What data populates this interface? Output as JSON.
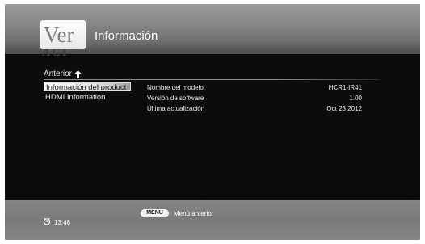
{
  "header": {
    "logo_text": "Ver",
    "logo_reflection": "AGI",
    "title": "Información"
  },
  "nav": {
    "back_label": "Anterior",
    "items": [
      {
        "label": "Información del product",
        "selected": true
      },
      {
        "label": "HDMI Information",
        "selected": false
      }
    ]
  },
  "info": {
    "rows": [
      {
        "label": "Nombre del modelo",
        "value": "HCR1-IR41"
      },
      {
        "label": "Versión de software",
        "value": "1.00"
      },
      {
        "label": "Última actualización",
        "value": "Oct 23 2012"
      }
    ]
  },
  "footer": {
    "time": "13:48",
    "menu_key": "MENU",
    "menu_hint": "Menú anterior"
  },
  "colors": {
    "background": "#0c0c0c",
    "header_gray": "#8a8a8a",
    "footer_gray": "#7f7f7f",
    "text": "#ededed",
    "selection": "#e0e0e0"
  },
  "icons": [
    "back-arrow-icon",
    "clock-icon"
  ]
}
